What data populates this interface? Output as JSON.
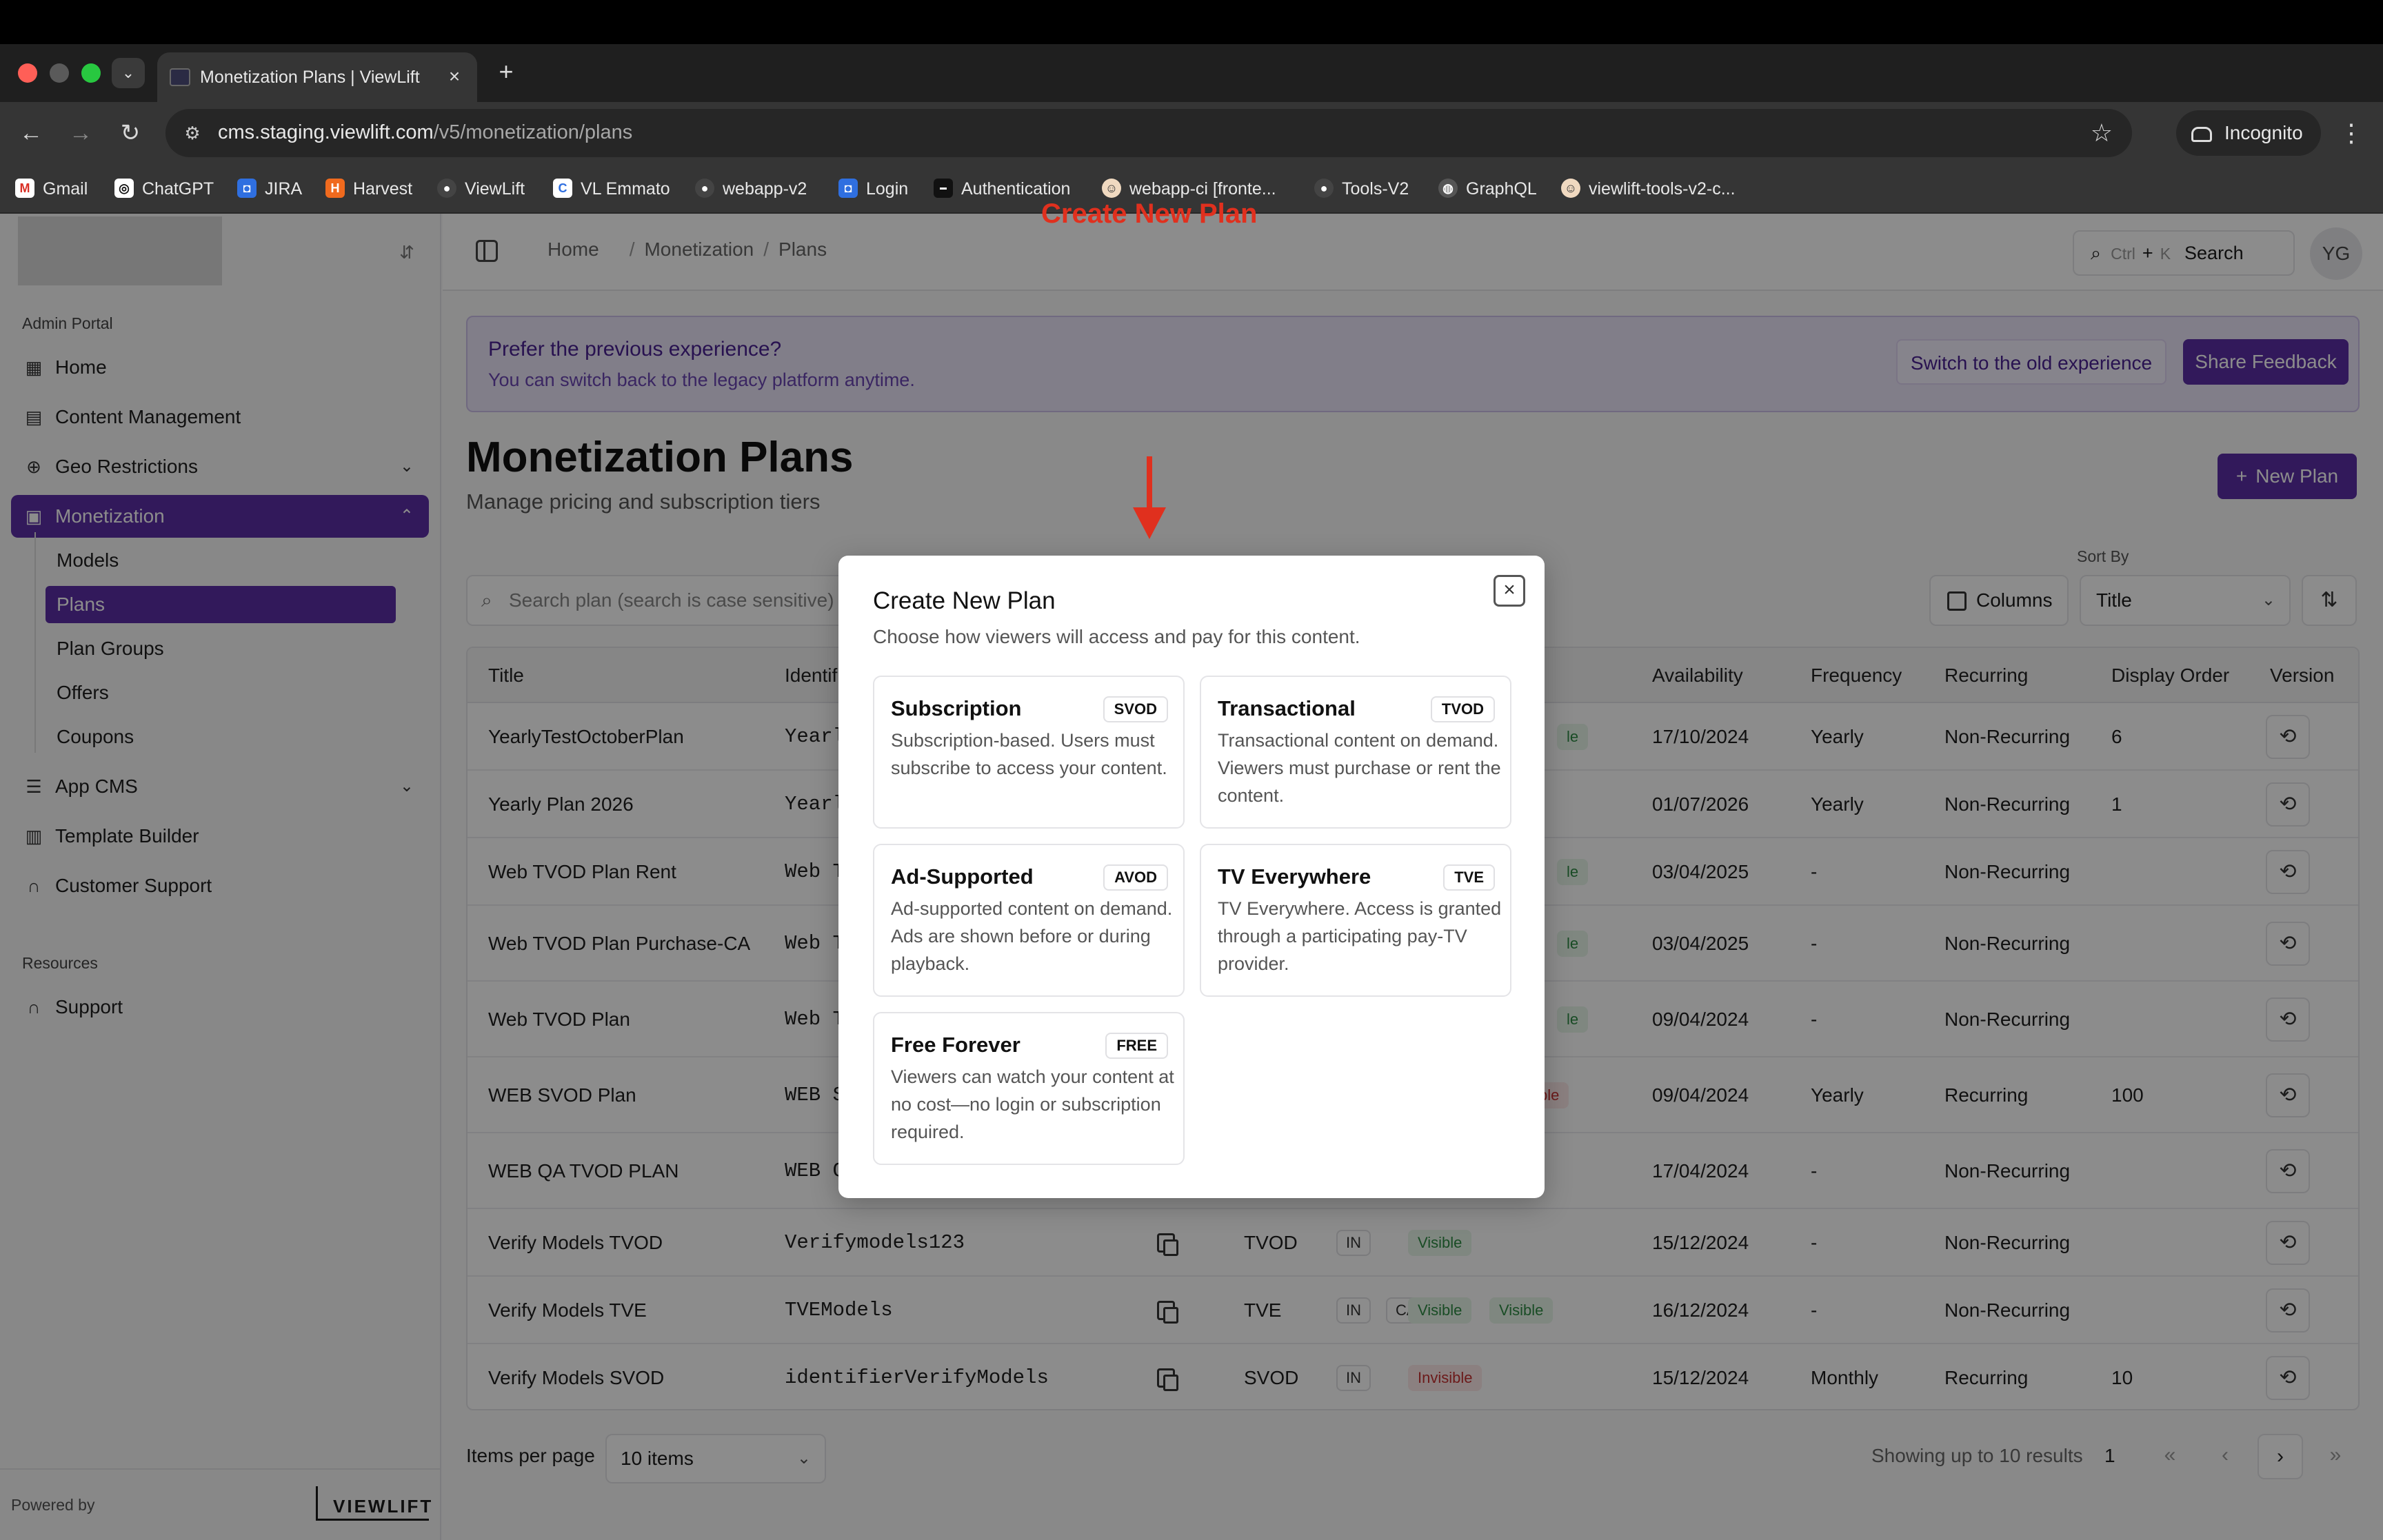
{
  "browser": {
    "tab_title": "Monetization Plans | ViewLift",
    "url_host": "cms.staging.viewlift.com",
    "url_path": "/v5/monetization/plans",
    "incognito_label": "Incognito",
    "bookmarks": [
      "Gmail",
      "ChatGPT",
      "JIRA",
      "Harvest",
      "ViewLift",
      "VL Emmato",
      "webapp-v2",
      "Login",
      "Authentication",
      "webapp-ci [fronte...",
      "Tools-V2",
      "GraphQL",
      "viewlift-tools-v2-c..."
    ]
  },
  "sidebar": {
    "section_admin": "Admin Portal",
    "items": [
      {
        "label": "Home",
        "icon": "grid-icon"
      },
      {
        "label": "Content Management",
        "icon": "film-icon"
      },
      {
        "label": "Geo Restrictions",
        "icon": "globe-icon"
      },
      {
        "label": "Monetization",
        "icon": "wallet-icon"
      },
      {
        "label": "App CMS",
        "icon": "sliders-icon"
      },
      {
        "label": "Template Builder",
        "icon": "layout-icon"
      },
      {
        "label": "Customer Support",
        "icon": "headset-icon"
      }
    ],
    "monetization_sub": [
      "Models",
      "Plans",
      "Plan Groups",
      "Offers",
      "Coupons"
    ],
    "section_resources": "Resources",
    "support_label": "Support",
    "powered_by": "Powered by",
    "brand": "VIEWLIFT"
  },
  "topbar": {
    "breadcrumb": [
      "Home",
      "Monetization",
      "Plans"
    ],
    "search_kbd_ctrl": "Ctrl",
    "search_kbd_plus": "+",
    "search_kbd_k": "K",
    "search_label": "Search",
    "avatar_initials": "YG"
  },
  "banner": {
    "title": "Prefer the previous experience?",
    "subtitle": "You can switch back to the legacy platform anytime.",
    "switch_label": "Switch to the old experience",
    "feedback_label": "Share Feedback"
  },
  "page": {
    "title": "Monetization Plans",
    "subtitle": "Manage pricing and subscription tiers",
    "new_plan_label": "New Plan",
    "annotation": "Create New Plan",
    "search_placeholder": "Search plan (search is case sensitive)",
    "columns_label": "Columns",
    "sort_by_label": "Sort By",
    "sort_value": "Title"
  },
  "table": {
    "headers": {
      "title": "Title",
      "identifier": "Identif",
      "availability": "Availability",
      "frequency": "Frequency",
      "recurring": "Recurring",
      "display_order": "Display Order",
      "version": "Version"
    },
    "rows": [
      {
        "title": "YearlyTestOctoberPlan",
        "identifier": "Yearl",
        "availability": "17/10/2024",
        "frequency": "Yearly",
        "recurring": "Non-Recurring",
        "order": "6"
      },
      {
        "title": "Yearly Plan 2026",
        "identifier": "Yearl",
        "availability": "01/07/2026",
        "frequency": "Yearly",
        "recurring": "Non-Recurring",
        "order": "1"
      },
      {
        "title": "Web TVOD Plan Rent",
        "identifier": "Web T",
        "availability": "03/04/2025",
        "frequency": "-",
        "recurring": "Non-Recurring",
        "order": ""
      },
      {
        "title": "Web TVOD Plan Purchase-CA",
        "identifier": "Web T",
        "availability": "03/04/2025",
        "frequency": "-",
        "recurring": "Non-Recurring",
        "order": ""
      },
      {
        "title": "Web TVOD Plan",
        "identifier": "Web T",
        "availability": "09/04/2024",
        "frequency": "-",
        "recurring": "Non-Recurring",
        "order": ""
      },
      {
        "title": "WEB SVOD Plan",
        "identifier": "WEB S",
        "availability": "09/04/2024",
        "frequency": "Yearly",
        "recurring": "Recurring",
        "order": "100"
      },
      {
        "title": "WEB QA TVOD PLAN",
        "identifier": "WEB Q",
        "availability": "17/04/2024",
        "frequency": "-",
        "recurring": "Non-Recurring",
        "order": ""
      },
      {
        "title": "Verify Models TVOD",
        "identifier": "Verifymodels123",
        "model": "TVOD",
        "regions": [
          "IN"
        ],
        "status": [
          "Visible"
        ],
        "availability": "15/12/2024",
        "frequency": "-",
        "recurring": "Non-Recurring",
        "order": ""
      },
      {
        "title": "Verify Models TVE",
        "identifier": "TVEModels",
        "model": "TVE",
        "regions": [
          "IN",
          "CA"
        ],
        "status": [
          "Visible",
          "Visible"
        ],
        "availability": "16/12/2024",
        "frequency": "-",
        "recurring": "Non-Recurring",
        "order": ""
      },
      {
        "title": "Verify Models SVOD",
        "identifier": "identifierVerifyModels",
        "model": "SVOD",
        "regions": [
          "IN"
        ],
        "status": [
          "Invisible"
        ],
        "availability": "15/12/2024",
        "frequency": "Monthly",
        "recurring": "Recurring",
        "order": "10"
      }
    ],
    "partial_badges": [
      "le",
      "le",
      "le",
      "le",
      "ble"
    ]
  },
  "pagination": {
    "items_per_page_label": "Items per page",
    "items_value": "10 items",
    "showing": "Showing up to 10 results",
    "current_page": "1"
  },
  "modal": {
    "title": "Create New Plan",
    "subtitle": "Choose how viewers will access and pay for this content.",
    "options": [
      {
        "title": "Subscription",
        "code": "SVOD",
        "desc": "Subscription-based. Users must subscribe to access your content."
      },
      {
        "title": "Transactional",
        "code": "TVOD",
        "desc": "Transactional content on demand. Viewers must purchase or rent the content."
      },
      {
        "title": "Ad-Supported",
        "code": "AVOD",
        "desc": "Ad-supported content on demand. Ads are shown before or during playback."
      },
      {
        "title": "TV Everywhere",
        "code": "TVE",
        "desc": "TV Everywhere. Access is granted through a participating pay-TV provider."
      },
      {
        "title": "Free Forever",
        "code": "FREE",
        "desc": "Viewers can watch your content at no cost—no login or subscription required."
      }
    ]
  },
  "colors": {
    "brand": "#5b2ea6",
    "annotation": "#e0301e",
    "visible": "#2f8a44",
    "invisible": "#c53030"
  }
}
